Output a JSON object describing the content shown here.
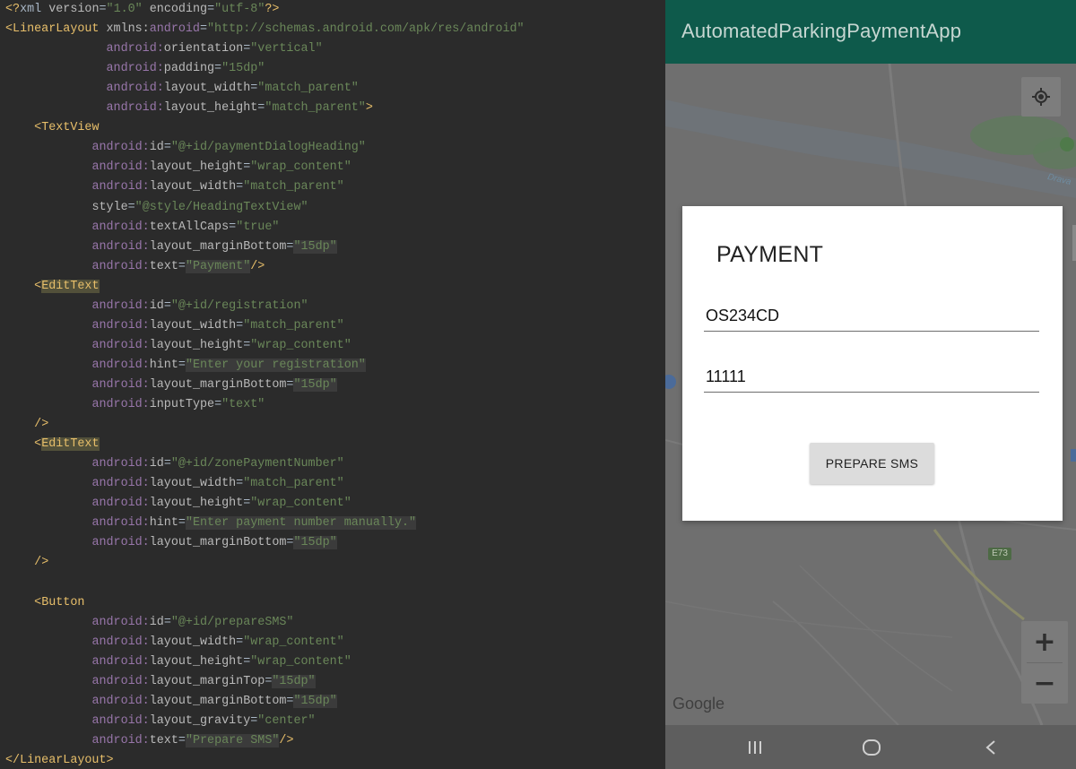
{
  "editor": {
    "lines": [
      [
        {
          "t": "<?",
          "c": "pi"
        },
        {
          "t": "xml ",
          "c": "txt"
        },
        {
          "t": "version",
          "c": "attr"
        },
        {
          "t": "=",
          "c": "txt"
        },
        {
          "t": "\"1.0\"",
          "c": "val"
        },
        {
          "t": " ",
          "c": "txt"
        },
        {
          "t": "encoding",
          "c": "attr"
        },
        {
          "t": "=",
          "c": "txt"
        },
        {
          "t": "\"utf-8\"",
          "c": "val"
        },
        {
          "t": "?>",
          "c": "pi"
        }
      ],
      [
        {
          "t": "<LinearLayout ",
          "c": "tag"
        },
        {
          "t": "xmlns:",
          "c": "attr"
        },
        {
          "t": "android",
          "c": "ns"
        },
        {
          "t": "=",
          "c": "txt"
        },
        {
          "t": "\"http://schemas.android.com/apk/res/android\"",
          "c": "val"
        }
      ],
      [
        {
          "t": "              ",
          "c": "txt"
        },
        {
          "t": "android:",
          "c": "ns"
        },
        {
          "t": "orientation",
          "c": "attr"
        },
        {
          "t": "=",
          "c": "txt"
        },
        {
          "t": "\"vertical\"",
          "c": "val"
        }
      ],
      [
        {
          "t": "              ",
          "c": "txt"
        },
        {
          "t": "android:",
          "c": "ns"
        },
        {
          "t": "padding",
          "c": "attr"
        },
        {
          "t": "=",
          "c": "txt"
        },
        {
          "t": "\"15dp\"",
          "c": "val"
        }
      ],
      [
        {
          "t": "              ",
          "c": "txt"
        },
        {
          "t": "android:",
          "c": "ns"
        },
        {
          "t": "layout_width",
          "c": "attr"
        },
        {
          "t": "=",
          "c": "txt"
        },
        {
          "t": "\"match_parent\"",
          "c": "val"
        }
      ],
      [
        {
          "t": "              ",
          "c": "txt"
        },
        {
          "t": "android:",
          "c": "ns"
        },
        {
          "t": "layout_height",
          "c": "attr"
        },
        {
          "t": "=",
          "c": "txt"
        },
        {
          "t": "\"match_parent\"",
          "c": "val"
        },
        {
          "t": ">",
          "c": "punct"
        }
      ],
      [
        {
          "t": "    ",
          "c": "txt"
        },
        {
          "t": "<TextView",
          "c": "tag"
        }
      ],
      [
        {
          "t": "            ",
          "c": "txt"
        },
        {
          "t": "android:",
          "c": "ns"
        },
        {
          "t": "id",
          "c": "attr"
        },
        {
          "t": "=",
          "c": "txt"
        },
        {
          "t": "\"@+id/paymentDialogHeading\"",
          "c": "val"
        }
      ],
      [
        {
          "t": "            ",
          "c": "txt"
        },
        {
          "t": "android:",
          "c": "ns"
        },
        {
          "t": "layout_height",
          "c": "attr"
        },
        {
          "t": "=",
          "c": "txt"
        },
        {
          "t": "\"wrap_content\"",
          "c": "val"
        }
      ],
      [
        {
          "t": "            ",
          "c": "txt"
        },
        {
          "t": "android:",
          "c": "ns"
        },
        {
          "t": "layout_width",
          "c": "attr"
        },
        {
          "t": "=",
          "c": "txt"
        },
        {
          "t": "\"match_parent\"",
          "c": "val"
        }
      ],
      [
        {
          "t": "            ",
          "c": "txt"
        },
        {
          "t": "style",
          "c": "attr"
        },
        {
          "t": "=",
          "c": "txt"
        },
        {
          "t": "\"@style/HeadingTextView\"",
          "c": "val"
        }
      ],
      [
        {
          "t": "            ",
          "c": "txt"
        },
        {
          "t": "android:",
          "c": "ns"
        },
        {
          "t": "textAllCaps",
          "c": "attr"
        },
        {
          "t": "=",
          "c": "txt"
        },
        {
          "t": "\"true\"",
          "c": "val"
        }
      ],
      [
        {
          "t": "            ",
          "c": "txt"
        },
        {
          "t": "android:",
          "c": "ns"
        },
        {
          "t": "layout_marginBottom",
          "c": "attr"
        },
        {
          "t": "=",
          "c": "txt"
        },
        {
          "t": "\"15dp\"",
          "c": "val bg"
        }
      ],
      [
        {
          "t": "            ",
          "c": "txt"
        },
        {
          "t": "android:",
          "c": "ns"
        },
        {
          "t": "text",
          "c": "attr"
        },
        {
          "t": "=",
          "c": "txt"
        },
        {
          "t": "\"Payment\"",
          "c": "val bg"
        },
        {
          "t": "/>",
          "c": "punct"
        }
      ],
      [
        {
          "t": "    ",
          "c": "txt"
        },
        {
          "t": "<",
          "c": "tag"
        },
        {
          "t": "EditText",
          "c": "tag hl"
        }
      ],
      [
        {
          "t": "            ",
          "c": "txt"
        },
        {
          "t": "android:",
          "c": "ns"
        },
        {
          "t": "id",
          "c": "attr"
        },
        {
          "t": "=",
          "c": "txt"
        },
        {
          "t": "\"@+id/registration\"",
          "c": "val"
        }
      ],
      [
        {
          "t": "            ",
          "c": "txt"
        },
        {
          "t": "android:",
          "c": "ns"
        },
        {
          "t": "layout_width",
          "c": "attr"
        },
        {
          "t": "=",
          "c": "txt"
        },
        {
          "t": "\"match_parent\"",
          "c": "val"
        }
      ],
      [
        {
          "t": "            ",
          "c": "txt"
        },
        {
          "t": "android:",
          "c": "ns"
        },
        {
          "t": "layout_height",
          "c": "attr"
        },
        {
          "t": "=",
          "c": "txt"
        },
        {
          "t": "\"wrap_content\"",
          "c": "val"
        }
      ],
      [
        {
          "t": "            ",
          "c": "txt"
        },
        {
          "t": "android:",
          "c": "ns"
        },
        {
          "t": "hint",
          "c": "attr"
        },
        {
          "t": "=",
          "c": "txt"
        },
        {
          "t": "\"Enter your registration\"",
          "c": "val bg"
        }
      ],
      [
        {
          "t": "            ",
          "c": "txt"
        },
        {
          "t": "android:",
          "c": "ns"
        },
        {
          "t": "layout_marginBottom",
          "c": "attr"
        },
        {
          "t": "=",
          "c": "txt"
        },
        {
          "t": "\"15dp\"",
          "c": "val bg"
        }
      ],
      [
        {
          "t": "            ",
          "c": "txt"
        },
        {
          "t": "android:",
          "c": "ns"
        },
        {
          "t": "inputType",
          "c": "attr"
        },
        {
          "t": "=",
          "c": "txt"
        },
        {
          "t": "\"text\"",
          "c": "val"
        }
      ],
      [
        {
          "t": "    ",
          "c": "txt"
        },
        {
          "t": "/>",
          "c": "punct"
        }
      ],
      [
        {
          "t": "    ",
          "c": "txt"
        },
        {
          "t": "<",
          "c": "tag"
        },
        {
          "t": "EditText",
          "c": "tag hl"
        }
      ],
      [
        {
          "t": "            ",
          "c": "txt"
        },
        {
          "t": "android:",
          "c": "ns"
        },
        {
          "t": "id",
          "c": "attr"
        },
        {
          "t": "=",
          "c": "txt"
        },
        {
          "t": "\"@+id/zonePaymentNumber\"",
          "c": "val"
        }
      ],
      [
        {
          "t": "            ",
          "c": "txt"
        },
        {
          "t": "android:",
          "c": "ns"
        },
        {
          "t": "layout_width",
          "c": "attr"
        },
        {
          "t": "=",
          "c": "txt"
        },
        {
          "t": "\"match_parent\"",
          "c": "val"
        }
      ],
      [
        {
          "t": "            ",
          "c": "txt"
        },
        {
          "t": "android:",
          "c": "ns"
        },
        {
          "t": "layout_height",
          "c": "attr"
        },
        {
          "t": "=",
          "c": "txt"
        },
        {
          "t": "\"wrap_content\"",
          "c": "val"
        }
      ],
      [
        {
          "t": "            ",
          "c": "txt"
        },
        {
          "t": "android:",
          "c": "ns"
        },
        {
          "t": "hint",
          "c": "attr"
        },
        {
          "t": "=",
          "c": "txt"
        },
        {
          "t": "\"Enter payment number manually.\"",
          "c": "val bg"
        }
      ],
      [
        {
          "t": "            ",
          "c": "txt"
        },
        {
          "t": "android:",
          "c": "ns"
        },
        {
          "t": "layout_marginBottom",
          "c": "attr"
        },
        {
          "t": "=",
          "c": "txt"
        },
        {
          "t": "\"15dp\"",
          "c": "val bg"
        }
      ],
      [
        {
          "t": "    ",
          "c": "txt"
        },
        {
          "t": "/>",
          "c": "punct"
        }
      ],
      [
        {
          "t": "",
          "c": "txt"
        }
      ],
      [
        {
          "t": "    ",
          "c": "txt"
        },
        {
          "t": "<Button",
          "c": "tag"
        }
      ],
      [
        {
          "t": "            ",
          "c": "txt"
        },
        {
          "t": "android:",
          "c": "ns"
        },
        {
          "t": "id",
          "c": "attr"
        },
        {
          "t": "=",
          "c": "txt"
        },
        {
          "t": "\"@+id/prepareSMS\"",
          "c": "val"
        }
      ],
      [
        {
          "t": "            ",
          "c": "txt"
        },
        {
          "t": "android:",
          "c": "ns"
        },
        {
          "t": "layout_width",
          "c": "attr"
        },
        {
          "t": "=",
          "c": "txt"
        },
        {
          "t": "\"wrap_content\"",
          "c": "val"
        }
      ],
      [
        {
          "t": "            ",
          "c": "txt"
        },
        {
          "t": "android:",
          "c": "ns"
        },
        {
          "t": "layout_height",
          "c": "attr"
        },
        {
          "t": "=",
          "c": "txt"
        },
        {
          "t": "\"wrap_content\"",
          "c": "val"
        }
      ],
      [
        {
          "t": "            ",
          "c": "txt"
        },
        {
          "t": "android:",
          "c": "ns"
        },
        {
          "t": "layout_marginTop",
          "c": "attr"
        },
        {
          "t": "=",
          "c": "txt"
        },
        {
          "t": "\"15dp\"",
          "c": "val bg"
        }
      ],
      [
        {
          "t": "            ",
          "c": "txt"
        },
        {
          "t": "android:",
          "c": "ns"
        },
        {
          "t": "layout_marginBottom",
          "c": "attr"
        },
        {
          "t": "=",
          "c": "txt"
        },
        {
          "t": "\"15dp\"",
          "c": "val bg"
        }
      ],
      [
        {
          "t": "            ",
          "c": "txt"
        },
        {
          "t": "android:",
          "c": "ns"
        },
        {
          "t": "layout_gravity",
          "c": "attr"
        },
        {
          "t": "=",
          "c": "txt"
        },
        {
          "t": "\"center\"",
          "c": "val"
        }
      ],
      [
        {
          "t": "            ",
          "c": "txt"
        },
        {
          "t": "android:",
          "c": "ns"
        },
        {
          "t": "text",
          "c": "attr"
        },
        {
          "t": "=",
          "c": "txt"
        },
        {
          "t": "\"Prepare SMS\"",
          "c": "val bg"
        },
        {
          "t": "/>",
          "c": "punct"
        }
      ],
      [
        {
          "t": "</LinearLayout>",
          "c": "tag"
        }
      ]
    ]
  },
  "app": {
    "title": "AutomatedParkingPaymentApp",
    "accent_color": "#0e5a4b",
    "map": {
      "river_label": "Drava",
      "road_label": "E73",
      "attribution": "Google",
      "zoom_in_label": "+",
      "zoom_out_label": "−",
      "locate_icon": "my-location-icon"
    },
    "nav": {
      "recents_icon": "recents-icon",
      "home_icon": "home-icon",
      "back_icon": "back-icon"
    }
  },
  "dialog": {
    "heading": "PAYMENT",
    "registration_value": "OS234CD",
    "registration_hint": "Enter your registration",
    "zone_value": "11111",
    "zone_hint": "Enter payment number manually.",
    "button_label": "PREPARE SMS"
  }
}
